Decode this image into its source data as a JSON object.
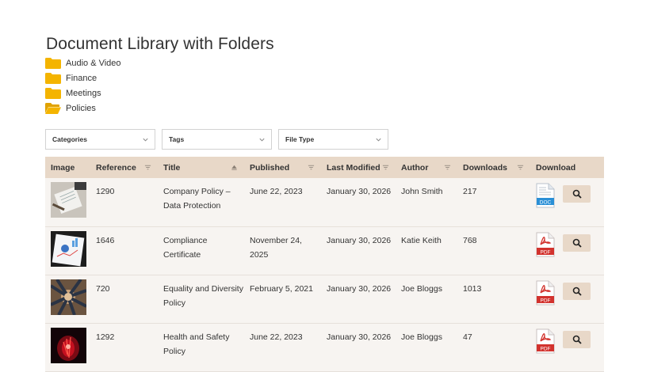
{
  "page": {
    "title": "Document Library with Folders"
  },
  "folders": [
    {
      "label": "Audio & Video",
      "icon": "folder-icon",
      "state": "closed"
    },
    {
      "label": "Finance",
      "icon": "folder-icon",
      "state": "closed"
    },
    {
      "label": "Meetings",
      "icon": "folder-icon",
      "state": "closed"
    },
    {
      "label": "Policies",
      "icon": "folder-open-icon",
      "state": "open"
    }
  ],
  "filters": [
    {
      "label": "Categories",
      "icon": "chevron-down-icon"
    },
    {
      "label": "Tags",
      "icon": "chevron-down-icon"
    },
    {
      "label": "File Type",
      "icon": "chevron-down-icon"
    }
  ],
  "table": {
    "columns": [
      {
        "label": "Image",
        "sort": "none"
      },
      {
        "label": "Reference",
        "sort": "sortable"
      },
      {
        "label": "Title",
        "sort": "ascending"
      },
      {
        "label": "Published",
        "sort": "sortable"
      },
      {
        "label": "Last Modified",
        "sort": "sortable"
      },
      {
        "label": "Author",
        "sort": "sortable"
      },
      {
        "label": "Downloads",
        "sort": "sortable"
      },
      {
        "label": "Download",
        "sort": "none"
      }
    ],
    "rows": [
      {
        "thumb": "paperwork-thumbnail",
        "reference": "1290",
        "title": "Company Policy – Data Protection",
        "published": "June 22, 2023",
        "modified": "January 30, 2026",
        "author": "John Smith",
        "downloads": "217",
        "file_type": "DOC"
      },
      {
        "thumb": "charts-thumbnail",
        "reference": "1646",
        "title": "Compliance Certificate",
        "published": "November 24, 2025",
        "modified": "January 30, 2026",
        "author": "Katie Keith",
        "downloads": "768",
        "file_type": "PDF"
      },
      {
        "thumb": "team-hands-thumbnail",
        "reference": "720",
        "title": "Equality and Diversity Policy",
        "published": "February 5, 2021",
        "modified": "January 30, 2026",
        "author": "Joe Bloggs",
        "downloads": "1013",
        "file_type": "PDF"
      },
      {
        "thumb": "red-light-thumbnail",
        "reference": "1292",
        "title": "Health and Safety Policy",
        "published": "June 22, 2023",
        "modified": "January 30, 2026",
        "author": "Joe Bloggs",
        "downloads": "47",
        "file_type": "PDF"
      }
    ]
  },
  "colors": {
    "header_bg": "#e8d8c8",
    "row_bg": "#f7f4f1",
    "folder": "#f4b400",
    "doc_blue": "#2a8fd6",
    "pdf_red": "#d2322d",
    "button_bg": "#e8d8c8"
  },
  "icons": {
    "view": "search-icon",
    "doc": "doc-file-icon",
    "pdf": "pdf-file-icon"
  }
}
